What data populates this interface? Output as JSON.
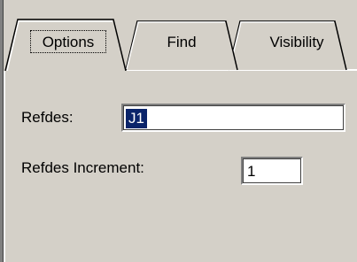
{
  "tabs": [
    {
      "label": "Options",
      "active": true
    },
    {
      "label": "Find",
      "active": false
    },
    {
      "label": "Visibility",
      "active": false
    }
  ],
  "fields": {
    "refdes": {
      "label": "Refdes:",
      "value": "J1",
      "selected": true
    },
    "increment": {
      "label": "Refdes Increment:",
      "value": "1"
    }
  },
  "colors": {
    "face": "#d4d0c8",
    "highlight": "#ffffff",
    "shadow": "#808080",
    "selection": "#0a246a"
  }
}
